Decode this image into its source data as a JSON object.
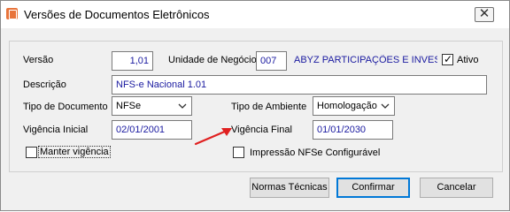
{
  "window": {
    "title": "Versões de Documentos Eletrônicos",
    "close_glyph": "✕"
  },
  "form": {
    "versao_label": "Versão",
    "versao_value": "1,01",
    "unidade_label": "Unidade de Negócio",
    "unidade_code": "007",
    "unidade_name": "ABYZ PARTICIPAÇÕES E INVESTIM",
    "ativo_label": "Ativo",
    "ativo_checked": true,
    "descricao_label": "Descrição",
    "descricao_value": "NFS-e Nacional 1.01",
    "tipo_documento_label": "Tipo de Documento",
    "tipo_documento_value": "NFSe",
    "tipo_ambiente_label": "Tipo de Ambiente",
    "tipo_ambiente_value": "Homologação",
    "vigencia_inicial_label": "Vigência Inicial",
    "vigencia_inicial_value": "02/01/2001",
    "vigencia_final_label": "Vigência Final",
    "vigencia_final_value": "01/01/2030",
    "manter_vigencia_label": "Manter vigência",
    "manter_vigencia_checked": false,
    "impressao_label": "Impressão NFSe Configurável",
    "impressao_checked": false
  },
  "buttons": {
    "normas": "Normas Técnicas",
    "confirmar": "Confirmar",
    "cancelar": "Cancelar"
  },
  "annotation": {
    "arrow_color": "#e02020"
  },
  "icons": [
    "app-document-icon",
    "close-icon",
    "chevron-down-icon",
    "checkmark-icon",
    "red-arrow-annotation"
  ]
}
